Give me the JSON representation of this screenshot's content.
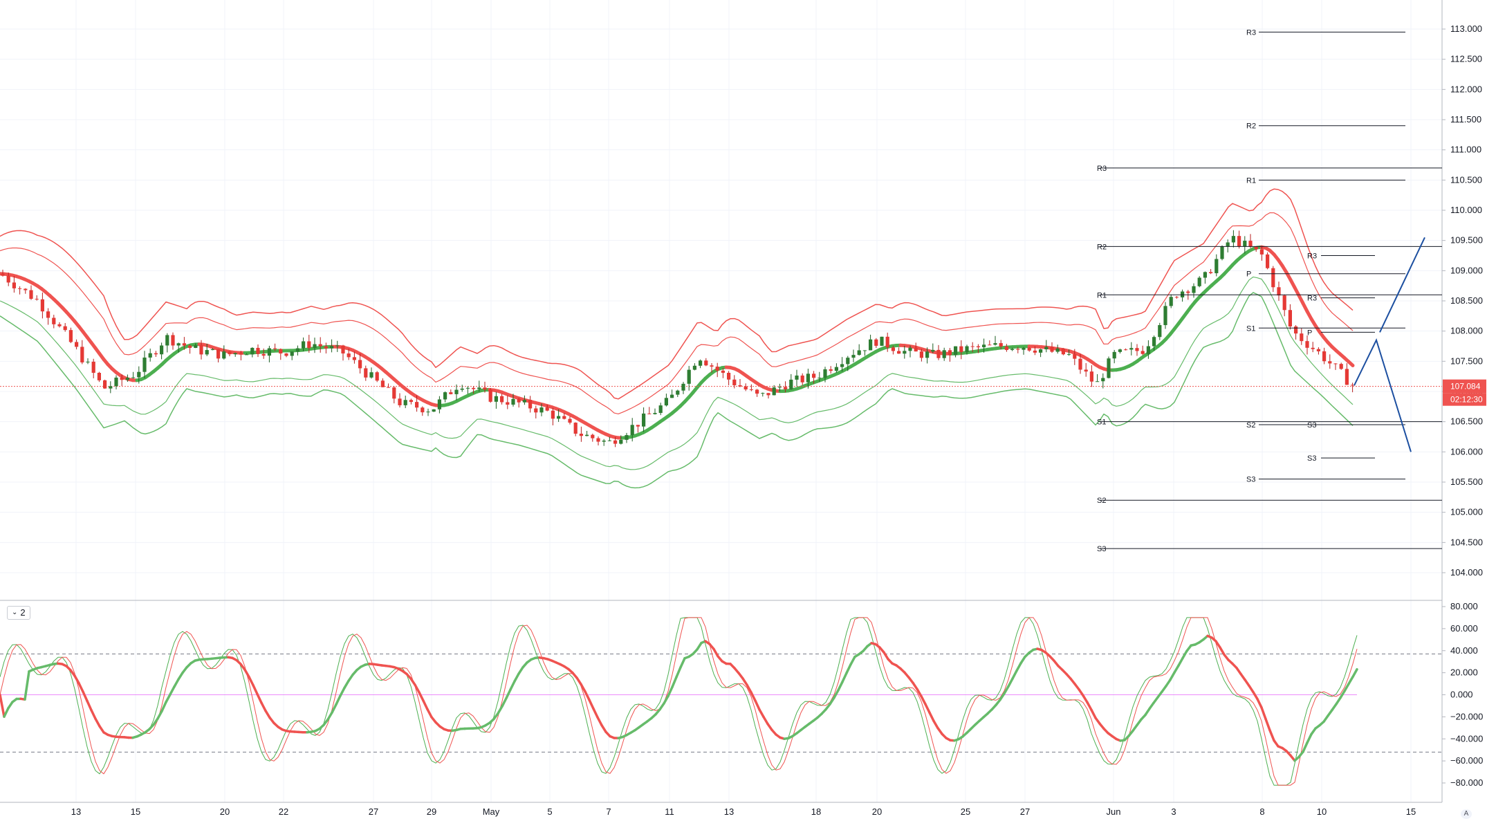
{
  "chart_data": [
    {
      "type": "candlestick",
      "symbol": "",
      "ylim": [
        103.7,
        114.0
      ],
      "price_ticks": [
        "113.000",
        "112.500",
        "112.000",
        "111.500",
        "111.000",
        "110.500",
        "110.000",
        "109.500",
        "109.000",
        "108.500",
        "108.000",
        "107.500",
        "107.000",
        "106.500",
        "106.000",
        "105.500",
        "105.000",
        "104.500",
        "104.000"
      ],
      "time_ticks": [
        "13",
        "15",
        "20",
        "22",
        "27",
        "29",
        "May",
        "5",
        "7",
        "11",
        "13",
        "18",
        "20",
        "25",
        "27",
        "Jun",
        "3",
        "8",
        "10",
        "15"
      ],
      "last_price": "107.084",
      "countdown": "02:12:30",
      "pivot_levels_long": [
        {
          "label": "R3",
          "value": 110.7
        },
        {
          "label": "R2",
          "value": 109.4
        },
        {
          "label": "R1",
          "value": 108.6
        },
        {
          "label": "S1",
          "value": 106.5
        },
        {
          "label": "S2",
          "value": 105.2
        },
        {
          "label": "S3",
          "value": 104.4
        }
      ],
      "pivot_levels_mid": [
        {
          "label": "R3",
          "value": 112.95
        },
        {
          "label": "R2",
          "value": 111.4
        },
        {
          "label": "R1",
          "value": 110.5
        },
        {
          "label": "P",
          "value": 108.95
        },
        {
          "label": "S1",
          "value": 108.05
        },
        {
          "label": "S2",
          "value": 106.45
        },
        {
          "label": "S3",
          "value": 105.55
        }
      ],
      "pivot_levels_short": [
        {
          "label": "R3",
          "value": 109.25
        },
        {
          "label": "R3",
          "value": 108.55
        },
        {
          "label": "P",
          "value": 107.98
        },
        {
          "label": "S3",
          "value": 106.45
        },
        {
          "label": "S3",
          "value": 105.9
        }
      ],
      "close_series_keypoints": [
        [
          "Apr 8",
          108.95
        ],
        [
          "Apr 10",
          108.5
        ],
        [
          "Apr 13",
          107.7
        ],
        [
          "Apr 14",
          107.05
        ],
        [
          "Apr 15",
          107.3
        ],
        [
          "Apr 16",
          107.9
        ],
        [
          "Apr 17",
          107.7
        ],
        [
          "Apr 20",
          107.6
        ],
        [
          "Apr 21",
          107.7
        ],
        [
          "Apr 22",
          107.65
        ],
        [
          "Apr 23",
          107.8
        ],
        [
          "Apr 24",
          107.65
        ],
        [
          "Apr 27",
          107.2
        ],
        [
          "Apr 28",
          106.8
        ],
        [
          "Apr 29",
          106.7
        ],
        [
          "Apr 30",
          107.15
        ],
        [
          "May 1",
          106.9
        ],
        [
          "May 4",
          106.8
        ],
        [
          "May 5",
          106.65
        ],
        [
          "May 6",
          106.3
        ],
        [
          "May 7",
          106.15
        ],
        [
          "May 8",
          106.5
        ],
        [
          "May 11",
          106.85
        ],
        [
          "May 12",
          107.6
        ],
        [
          "May 13",
          107.2
        ],
        [
          "May 14",
          106.9
        ],
        [
          "May 15",
          107.15
        ],
        [
          "May 18",
          107.25
        ],
        [
          "May 19",
          107.6
        ],
        [
          "May 20",
          107.85
        ],
        [
          "May 21",
          107.65
        ],
        [
          "May 22",
          107.6
        ],
        [
          "May 25",
          107.7
        ],
        [
          "May 26",
          107.75
        ],
        [
          "May 27",
          107.75
        ],
        [
          "May 28",
          107.6
        ],
        [
          "May 29",
          107.1
        ],
        [
          "Jun 1",
          107.6
        ],
        [
          "Jun 2",
          107.7
        ],
        [
          "Jun 3",
          108.6
        ],
        [
          "Jun 4",
          108.85
        ],
        [
          "Jun 5",
          109.55
        ],
        [
          "Jun 8",
          109.25
        ],
        [
          "Jun 9",
          108.0
        ],
        [
          "Jun 10",
          107.6
        ],
        [
          "Jun 11",
          107.08
        ]
      ],
      "oscillator": {
        "label": "2",
        "ylim": [
          -90,
          90
        ],
        "ticks": [
          "80.000",
          "60.000",
          "40.000",
          "20.000",
          "0.000",
          "−20.000",
          "−40.000",
          "−60.000",
          "−80.000"
        ],
        "levels": [
          37,
          0,
          -52
        ],
        "colors": {
          "up": "#4caf50",
          "down": "#ef5350",
          "zero": "#e040fb"
        }
      },
      "annotation": "zigzag projection",
      "colors": {
        "bull": "#26a69a",
        "bear": "#ef5350",
        "line": "#ff5252",
        "band_upper": "#ef5350",
        "band_lower": "#4caf50",
        "zigzag": "#1c4fa0"
      }
    }
  ]
}
